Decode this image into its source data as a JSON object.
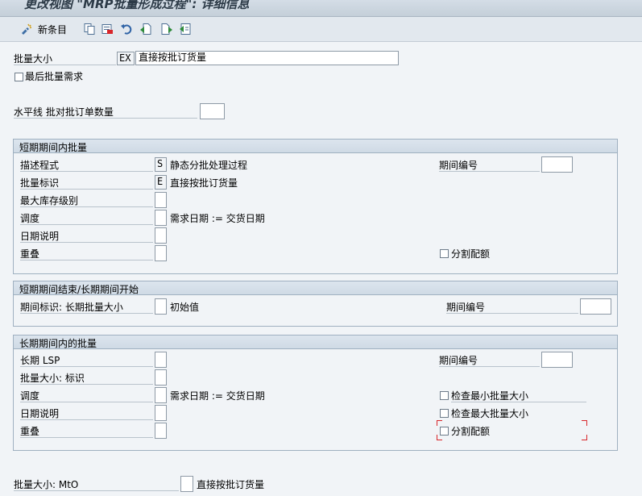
{
  "window": {
    "title": "更改视图 \"MRP批量形成过程\": 详细信息"
  },
  "toolbar": {
    "new_entries": "新条目"
  },
  "header": {
    "lot_size_label": "批量大小",
    "lot_size_code": "EX",
    "lot_size_text": "直接按批订货量",
    "last_lot_req_label": "最后批量需求",
    "horizon_label": "水平线 批对批订单数量"
  },
  "short_term": {
    "title": "短期期间内批量",
    "procedure_label": "描述程式",
    "procedure_value": "S",
    "procedure_text": "静态分批处理过程",
    "period_no_label": "期间编号",
    "lot_size_ind_label": "批量标识",
    "lot_size_ind_value": "E",
    "lot_size_ind_text": "直接按批订货量",
    "max_stock_label": "最大库存级别",
    "scheduling_label": "调度",
    "scheduling_text": "需求日期 := 交货日期",
    "date_spec_label": "日期说明",
    "overlap_label": "重叠",
    "split_quota_label": "分割配额"
  },
  "transition": {
    "title": "短期期间结束/长期期间开始",
    "period_ind_label": "期间标识: 长期批量大小",
    "period_ind_text": "初始值",
    "period_no_label": "期间编号"
  },
  "long_term": {
    "title": "长期期间内的批量",
    "lsp_label": "长期 LSP",
    "period_no_label": "期间编号",
    "lot_size_ind_label": "批量大小: 标识",
    "scheduling_label": "调度",
    "scheduling_text": "需求日期 := 交货日期",
    "check_min_label": "检查最小批量大小",
    "date_spec_label": "日期说明",
    "check_max_label": "检查最大批量大小",
    "overlap_label": "重叠",
    "split_quota_label": "分割配额"
  },
  "footer": {
    "mto_label": "批量大小: MtO",
    "mto_text": "直接按批订货量"
  },
  "colors": {
    "focus": "#d8262b",
    "group_border": "#9fb0c0",
    "background": "#f1f4f7"
  }
}
